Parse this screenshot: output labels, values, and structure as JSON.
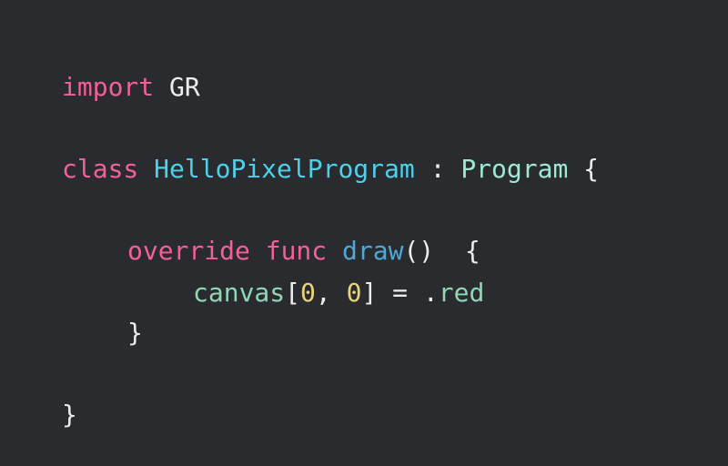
{
  "theme": {
    "background": "#2a2b2f",
    "keyword": "#f2609a",
    "plain": "#ececec",
    "type_name": "#4fd0e8",
    "superclass": "#9ee8d4",
    "function": "#4fa8d8",
    "identifier": "#8fd7b6",
    "number": "#e9d47a"
  },
  "code": {
    "line1": {
      "kw": "import",
      "module": "GR"
    },
    "line2": {
      "kw": "class",
      "name": "HelloPixelProgram",
      "colon": " : ",
      "superclass": "Program",
      "brace_open": " {"
    },
    "line3": {
      "kw_override": "override",
      "kw_func": "func",
      "fn": "draw",
      "parens": "()",
      "brace_open": "  {"
    },
    "line4": {
      "ident": "canvas",
      "bracket_open": "[",
      "arg1": "0",
      "comma": ", ",
      "arg2": "0",
      "bracket_close": "]",
      "assign": " = ",
      "dot": ".",
      "member": "red"
    },
    "line5": {
      "brace_close": "}"
    },
    "line6": {
      "brace_close": "}"
    }
  }
}
